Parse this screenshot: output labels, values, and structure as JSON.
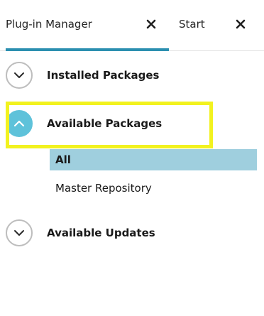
{
  "tabs": [
    {
      "label": "Plug-in Manager",
      "active": true
    },
    {
      "label": "Start",
      "active": false
    }
  ],
  "sections": {
    "installed": {
      "label": "Installed Packages",
      "expanded": false
    },
    "available": {
      "label": "Available Packages",
      "expanded": true
    },
    "updates": {
      "label": "Available Updates",
      "expanded": false
    }
  },
  "available_items": [
    {
      "label": "All",
      "selected": true
    },
    {
      "label": "Master Repository",
      "selected": false
    }
  ],
  "colors": {
    "accent": "#2b8fb0",
    "expanded_chevron": "#5ec2da",
    "selection": "#9fcfde",
    "highlight": "#f2f21f"
  },
  "icons": {
    "tab_close": "close-icon",
    "collapsed": "chevron-down-icon",
    "expanded": "chevron-up-icon"
  }
}
